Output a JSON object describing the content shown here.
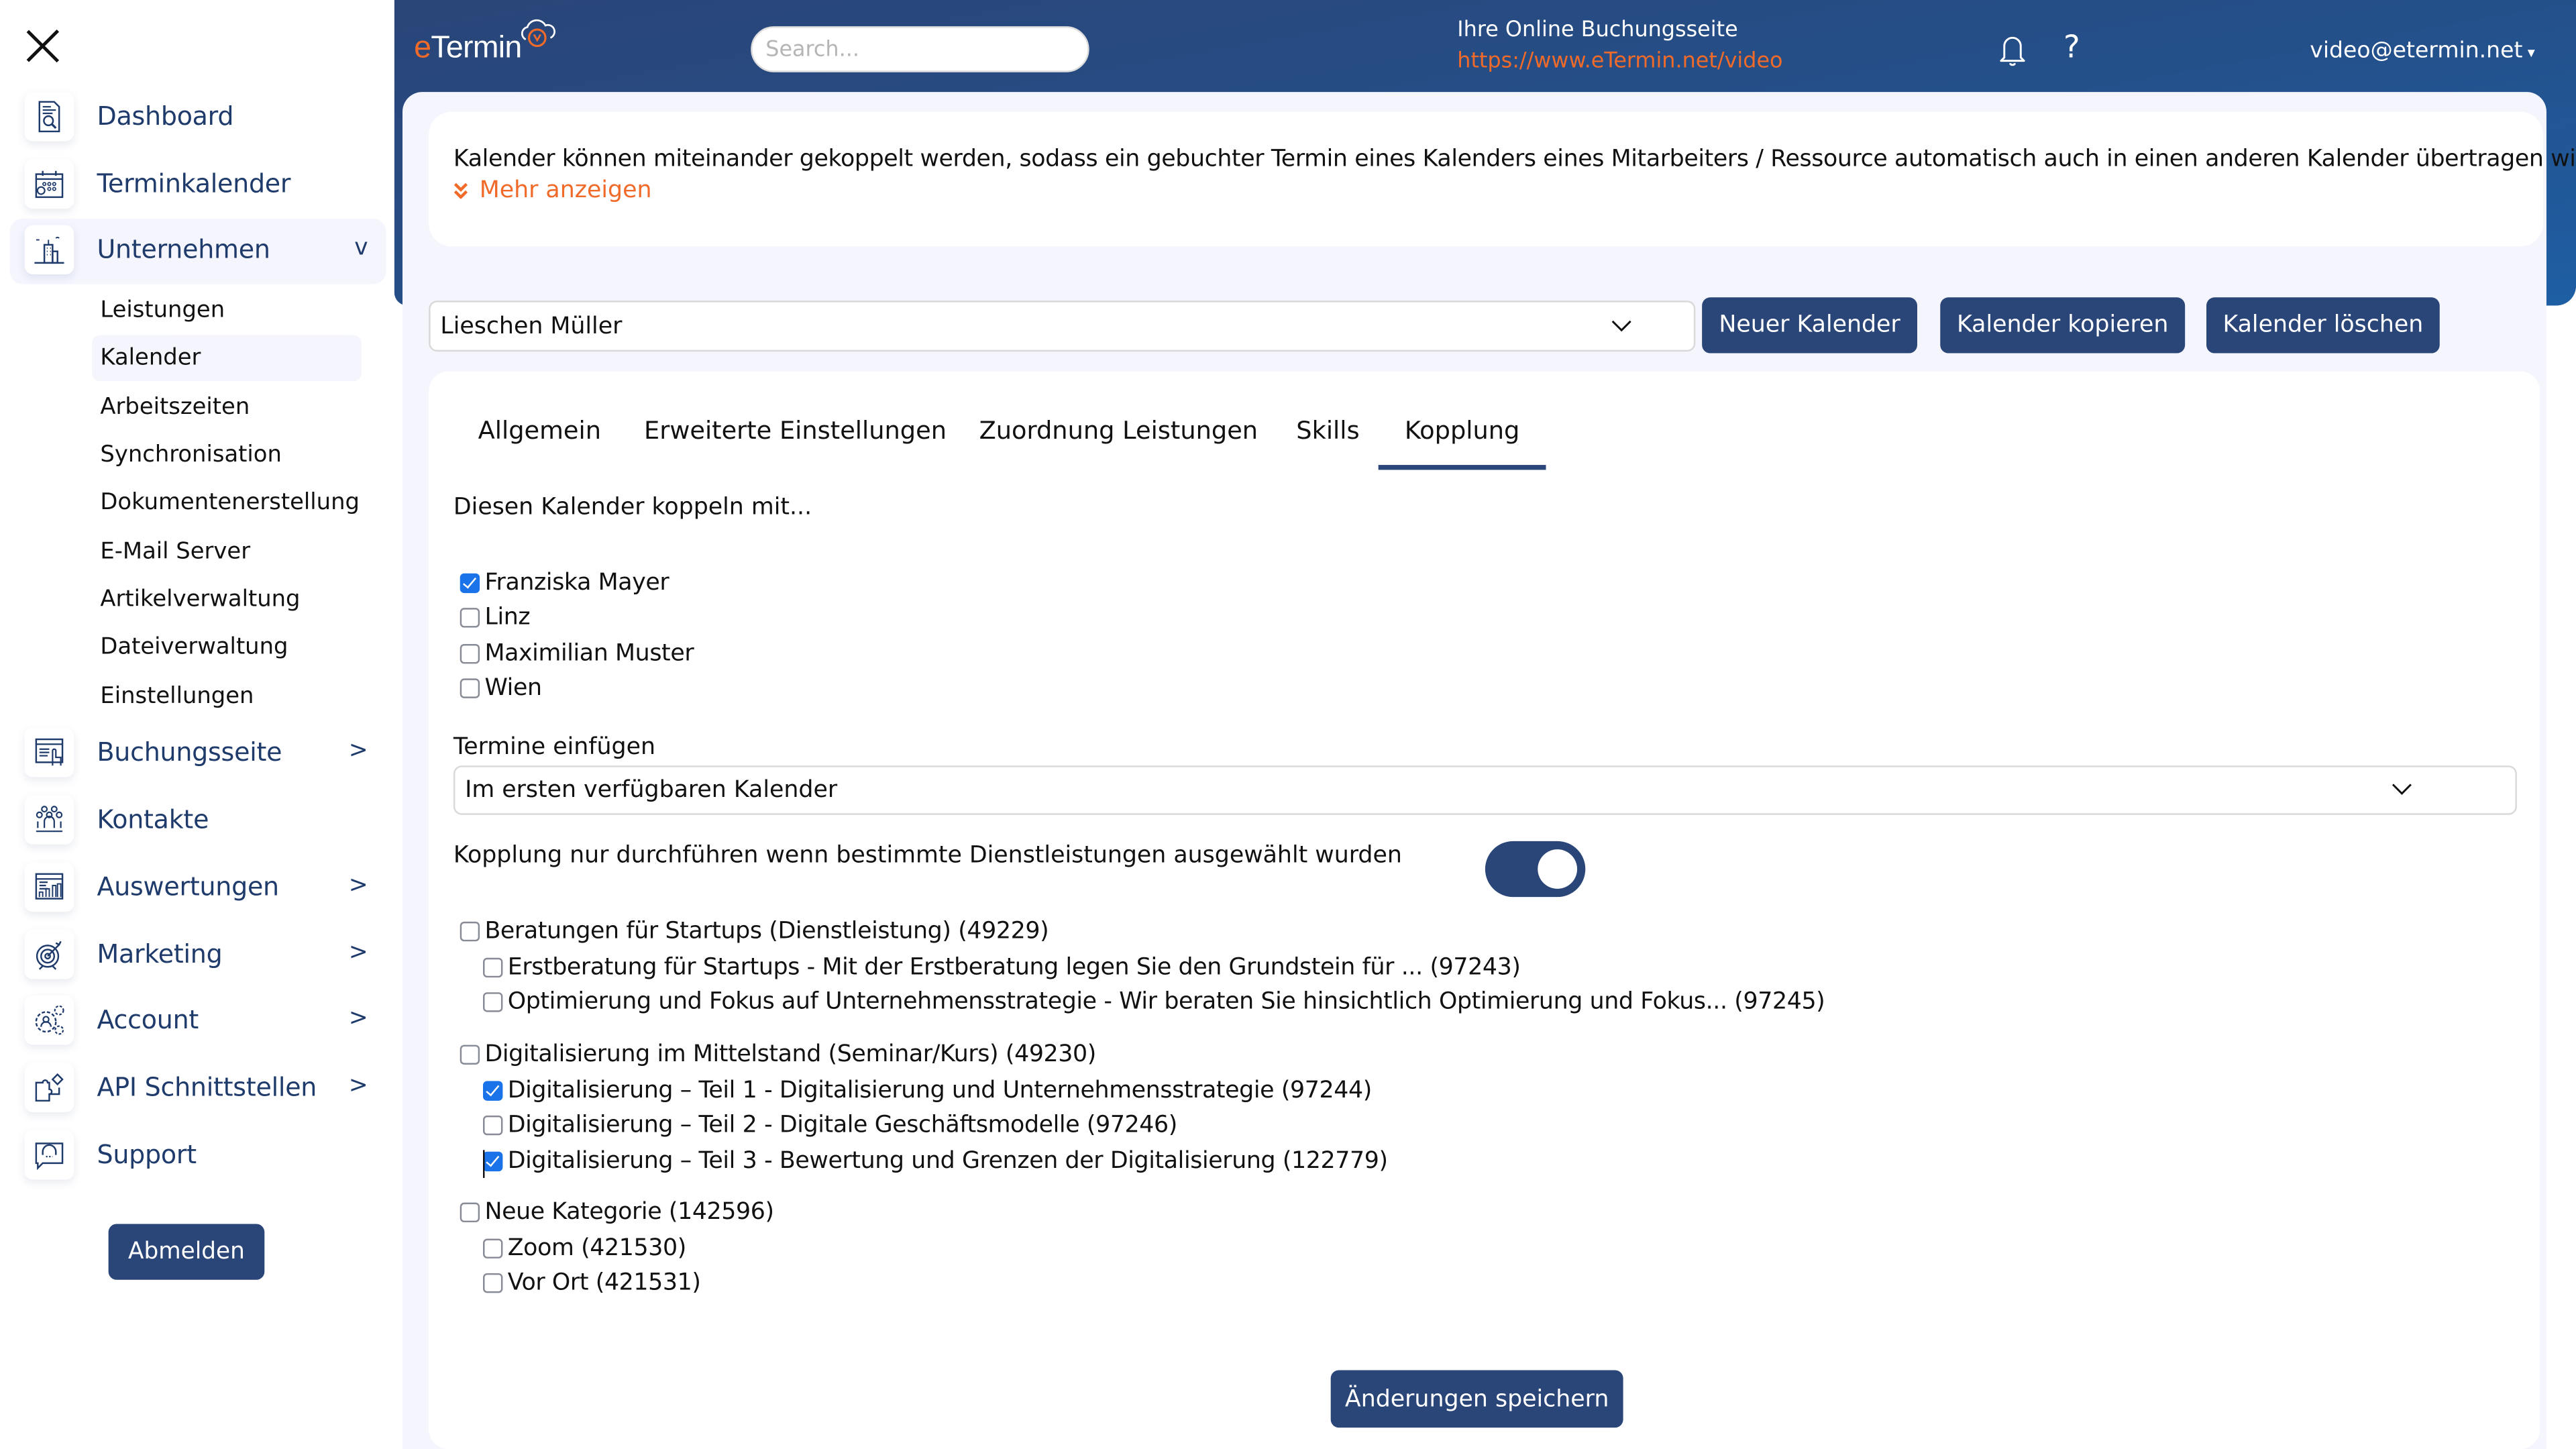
{
  "sidebar": {
    "close_icon": "close-icon",
    "items": [
      {
        "label": "Dashboard",
        "icon": "dashboard-report-icon",
        "arrow": ""
      },
      {
        "label": "Terminkalender",
        "icon": "calendar-icon",
        "arrow": ""
      },
      {
        "label": "Unternehmen",
        "icon": "building-icon",
        "arrow": "v"
      },
      {
        "label": "Buchungsseite",
        "icon": "booking-page-icon",
        "arrow": ">"
      },
      {
        "label": "Kontakte",
        "icon": "contacts-group-icon",
        "arrow": ""
      },
      {
        "label": "Auswertungen",
        "icon": "statistics-icon",
        "arrow": ">"
      },
      {
        "label": "Marketing",
        "icon": "target-icon",
        "arrow": ">"
      },
      {
        "label": "Account",
        "icon": "account-gears-icon",
        "arrow": ">"
      },
      {
        "label": "API Schnittstellen",
        "icon": "puzzle-icon",
        "arrow": ">"
      },
      {
        "label": "Support",
        "icon": "support-headset-icon",
        "arrow": ""
      }
    ],
    "submenu": [
      {
        "label": "Leistungen"
      },
      {
        "label": "Kalender"
      },
      {
        "label": "Arbeitszeiten"
      },
      {
        "label": "Synchronisation"
      },
      {
        "label": "Dokumentenerstellung"
      },
      {
        "label": "E-Mail Server"
      },
      {
        "label": "Artikelverwaltung"
      },
      {
        "label": "Dateiverwaltung"
      },
      {
        "label": "Einstellungen"
      }
    ],
    "active_item": "Unternehmen",
    "active_subitem": "Kalender",
    "logout_label": "Abmelden"
  },
  "header": {
    "logo_prefix": "e",
    "logo_rest": "Termin",
    "search_placeholder": "Search...",
    "search_value": "",
    "booking_title": "Ihre Online Buchungsseite",
    "booking_url": "https://www.eTermin.net/video",
    "user_email": "video@etermin.net",
    "user_caret": "▾",
    "help_label": "?"
  },
  "info": {
    "text": "Kalender können miteinander gekoppelt werden, sodass ein gebuchter Termin eines Kalenders eines Mitarbeiters / Ressource automatisch auch in einen anderen Kalender übertragen wird.",
    "more_icon": "»",
    "more_label": "Mehr anzeigen"
  },
  "calendar_bar": {
    "selected_calendar": "Lieschen Müller",
    "buttons": {
      "new": "Neuer Kalender",
      "copy": "Kalender kopieren",
      "delete": "Kalender löschen"
    }
  },
  "tabs": [
    {
      "label": "Allgemein",
      "active": false
    },
    {
      "label": "Erweiterte Einstellungen",
      "active": false
    },
    {
      "label": "Zuordnung Leistungen",
      "active": false
    },
    {
      "label": "Skills",
      "active": false
    },
    {
      "label": "Kopplung",
      "active": true
    }
  ],
  "kopplung": {
    "couple_label": "Diesen Kalender koppeln mit...",
    "calendars": [
      {
        "label": "Franziska Mayer",
        "checked": true
      },
      {
        "label": "Linz",
        "checked": false
      },
      {
        "label": "Maximilian Muster",
        "checked": false
      },
      {
        "label": "Wien",
        "checked": false
      }
    ],
    "insert_label": "Termine einfügen",
    "insert_value": "Im ersten verfügbaren Kalender",
    "toggle_label": "Kopplung nur durchführen wenn bestimmte Dienstleistungen ausgewählt wurden",
    "toggle_on": true,
    "service_groups": [
      {
        "label": "Beratungen für Startups (Dienstleistung) (49229)",
        "checked": false,
        "children": [
          {
            "label": "Erstberatung für Startups - Mit der Erstberatung legen Sie den Grundstein für ... (97243)",
            "checked": false
          },
          {
            "label": "Optimierung und Fokus auf Unternehmensstrategie - Wir beraten Sie hinsichtlich Optimierung und Fokus... (97245)",
            "checked": false
          }
        ]
      },
      {
        "label": "Digitalisierung im Mittelstand (Seminar/Kurs) (49230)",
        "checked": false,
        "children": [
          {
            "label": "Digitalisierung – Teil 1 - Digitalisierung und Unternehmensstrategie (97244)",
            "checked": true
          },
          {
            "label": "Digitalisierung – Teil 2 - Digitale Geschäftsmodelle (97246)",
            "checked": false
          },
          {
            "label": "Digitalisierung – Teil 3 - Bewertung und Grenzen der Digitalisierung (122779)",
            "checked": true
          }
        ]
      },
      {
        "label": "Neue Kategorie (142596)",
        "checked": false,
        "children": [
          {
            "label": "Zoom (421530)",
            "checked": false
          },
          {
            "label": "Vor Ort (421531)",
            "checked": false
          }
        ]
      }
    ],
    "save_label": "Änderungen speichern"
  },
  "colors": {
    "primary": "#2a4578",
    "accent": "#f06a2a",
    "checkbox_checked": "#1a73e8",
    "panel_bg": "#f5f6fd"
  }
}
